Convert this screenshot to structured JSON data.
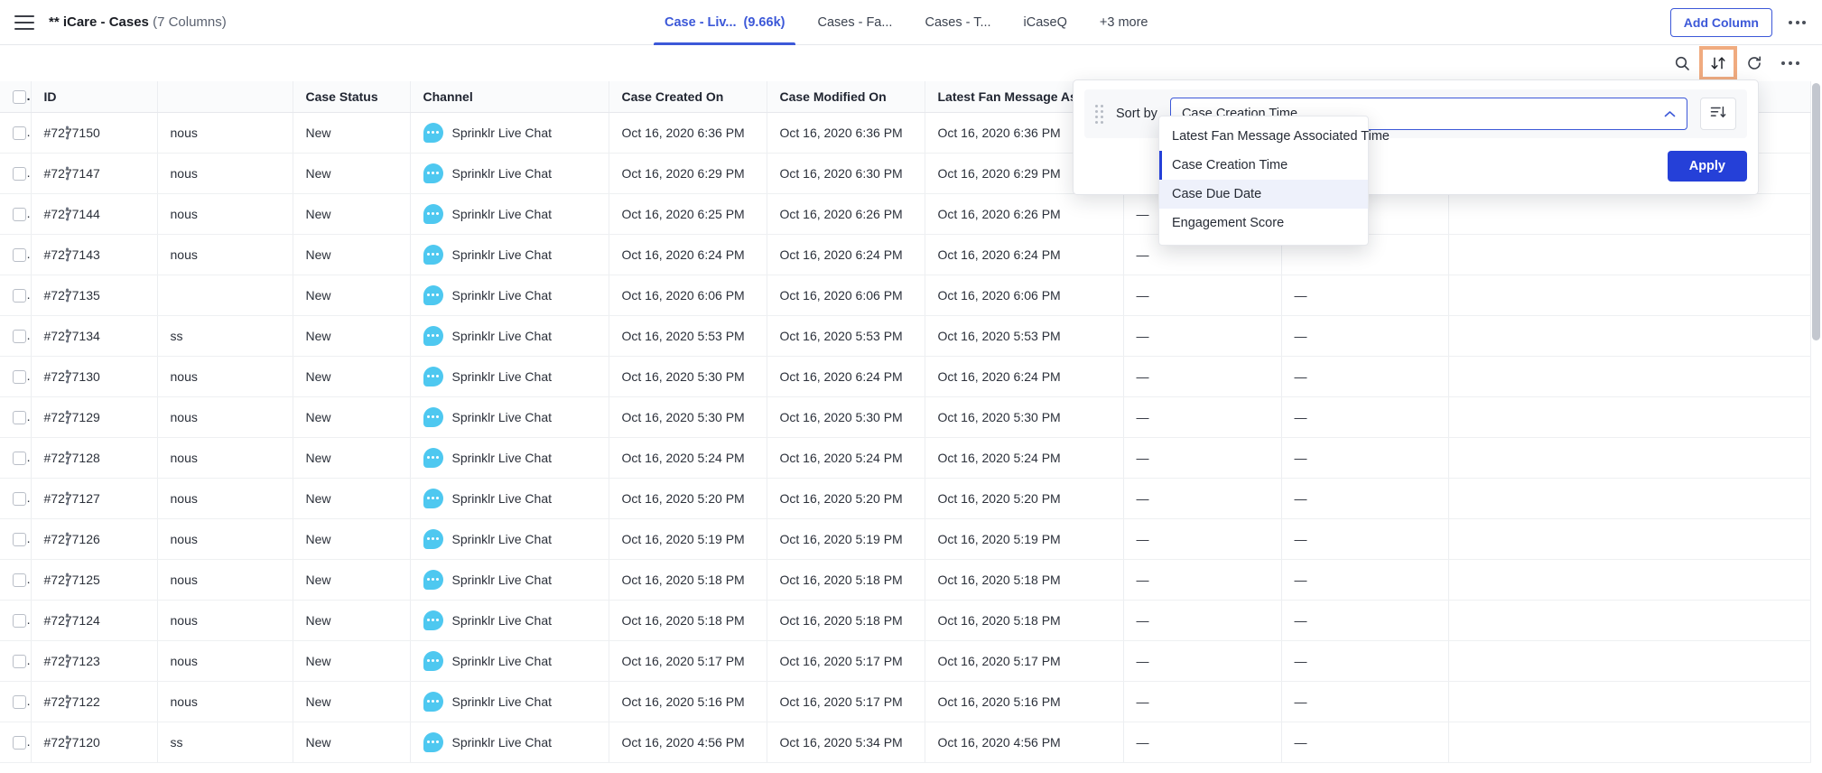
{
  "header": {
    "menu_icon": "hamburger-menu-icon",
    "title_bold": "** iCare - Cases",
    "title_columns": "(7 Columns)",
    "add_column_label": "Add Column",
    "overflow_icon": "kebab-menu-icon",
    "tabs": [
      {
        "label": "Case - Liv...",
        "count": "(9.66k)",
        "active": true
      },
      {
        "label": "Cases - Fa...",
        "count": "",
        "active": false
      },
      {
        "label": "Cases - T...",
        "count": "",
        "active": false
      },
      {
        "label": "iCaseQ",
        "count": "",
        "active": false
      },
      {
        "label": "+3 more",
        "count": "",
        "active": false
      }
    ]
  },
  "toolbar": {
    "search_icon": "search-icon",
    "sort_icon": "sort-arrows-icon",
    "refresh_icon": "refresh-icon",
    "more_icon": "more-horizontal-icon",
    "highlight_color": "#f0ab7f",
    "active_tool": "sort-arrows-icon"
  },
  "sort_panel": {
    "sort_by_label": "Sort by",
    "selected_field": "Case Creation Time",
    "caret_icon": "chevron-up-icon",
    "drag_handle_icon": "drag-handle-icon",
    "order_icon": "sort-descending-icon",
    "apply_label": "Apply",
    "options": [
      {
        "label": "Latest Fan Message Associated Time",
        "state": "normal"
      },
      {
        "label": "Case Creation Time",
        "state": "selected"
      },
      {
        "label": "Case Due Date",
        "state": "hover"
      },
      {
        "label": "Engagement Score",
        "state": "normal"
      }
    ]
  },
  "table": {
    "columns": [
      {
        "key": "check",
        "label": "",
        "cls": "c-check"
      },
      {
        "key": "id",
        "label": "ID",
        "cls": "c-id"
      },
      {
        "key": "name",
        "label": "",
        "cls": "c-name"
      },
      {
        "key": "status",
        "label": "Case Status",
        "cls": "c-status"
      },
      {
        "key": "channel",
        "label": "Channel",
        "cls": "c-channel"
      },
      {
        "key": "created",
        "label": "Case Created On",
        "cls": "c-created"
      },
      {
        "key": "modified",
        "label": "Case Modified On",
        "cls": "c-modified"
      },
      {
        "key": "latest",
        "label": "Latest Fan Message Associate...",
        "cls": "c-latest"
      },
      {
        "key": "d1",
        "label": "",
        "cls": "c-d1"
      },
      {
        "key": "d2",
        "label": "",
        "cls": "c-d2"
      },
      {
        "key": "d3",
        "label": "",
        "cls": "c-d3"
      }
    ],
    "channel_label": "Sprinklr Live Chat",
    "channel_icon": "chat-bubble-icon",
    "empty_value": "—",
    "rows": [
      {
        "id": "#7277150",
        "name": "nous",
        "status": "New",
        "created": "Oct 16, 2020 6:36 PM",
        "modified": "Oct 16, 2020 6:36 PM",
        "latest": "Oct 16, 2020 6:36 PM",
        "d1": "",
        "d2": "",
        "d3": ""
      },
      {
        "id": "#7277147",
        "name": "nous",
        "status": "New",
        "created": "Oct 16, 2020 6:29 PM",
        "modified": "Oct 16, 2020 6:30 PM",
        "latest": "Oct 16, 2020 6:29 PM",
        "d1": "",
        "d2": "",
        "d3": ""
      },
      {
        "id": "#7277144",
        "name": "nous",
        "status": "New",
        "created": "Oct 16, 2020 6:25 PM",
        "modified": "Oct 16, 2020 6:26 PM",
        "latest": "Oct 16, 2020 6:26 PM",
        "d1": "—",
        "d2": "",
        "d3": ""
      },
      {
        "id": "#7277143",
        "name": "nous",
        "status": "New",
        "created": "Oct 16, 2020 6:24 PM",
        "modified": "Oct 16, 2020 6:24 PM",
        "latest": "Oct 16, 2020 6:24 PM",
        "d1": "—",
        "d2": "",
        "d3": ""
      },
      {
        "id": "#7277135",
        "name": "",
        "status": "New",
        "created": "Oct 16, 2020 6:06 PM",
        "modified": "Oct 16, 2020 6:06 PM",
        "latest": "Oct 16, 2020 6:06 PM",
        "d1": "—",
        "d2": "—",
        "d3": ""
      },
      {
        "id": "#7277134",
        "name": "ss",
        "status": "New",
        "created": "Oct 16, 2020 5:53 PM",
        "modified": "Oct 16, 2020 5:53 PM",
        "latest": "Oct 16, 2020 5:53 PM",
        "d1": "—",
        "d2": "—",
        "d3": ""
      },
      {
        "id": "#7277130",
        "name": "nous",
        "status": "New",
        "created": "Oct 16, 2020 5:30 PM",
        "modified": "Oct 16, 2020 6:24 PM",
        "latest": "Oct 16, 2020 6:24 PM",
        "d1": "—",
        "d2": "—",
        "d3": ""
      },
      {
        "id": "#7277129",
        "name": "nous",
        "status": "New",
        "created": "Oct 16, 2020 5:30 PM",
        "modified": "Oct 16, 2020 5:30 PM",
        "latest": "Oct 16, 2020 5:30 PM",
        "d1": "—",
        "d2": "—",
        "d3": ""
      },
      {
        "id": "#7277128",
        "name": "nous",
        "status": "New",
        "created": "Oct 16, 2020 5:24 PM",
        "modified": "Oct 16, 2020 5:24 PM",
        "latest": "Oct 16, 2020 5:24 PM",
        "d1": "—",
        "d2": "—",
        "d3": ""
      },
      {
        "id": "#7277127",
        "name": "nous",
        "status": "New",
        "created": "Oct 16, 2020 5:20 PM",
        "modified": "Oct 16, 2020 5:20 PM",
        "latest": "Oct 16, 2020 5:20 PM",
        "d1": "—",
        "d2": "—",
        "d3": ""
      },
      {
        "id": "#7277126",
        "name": "nous",
        "status": "New",
        "created": "Oct 16, 2020 5:19 PM",
        "modified": "Oct 16, 2020 5:19 PM",
        "latest": "Oct 16, 2020 5:19 PM",
        "d1": "—",
        "d2": "—",
        "d3": ""
      },
      {
        "id": "#7277125",
        "name": "nous",
        "status": "New",
        "created": "Oct 16, 2020 5:18 PM",
        "modified": "Oct 16, 2020 5:18 PM",
        "latest": "Oct 16, 2020 5:18 PM",
        "d1": "—",
        "d2": "—",
        "d3": ""
      },
      {
        "id": "#7277124",
        "name": "nous",
        "status": "New",
        "created": "Oct 16, 2020 5:18 PM",
        "modified": "Oct 16, 2020 5:18 PM",
        "latest": "Oct 16, 2020 5:18 PM",
        "d1": "—",
        "d2": "—",
        "d3": ""
      },
      {
        "id": "#7277123",
        "name": "nous",
        "status": "New",
        "created": "Oct 16, 2020 5:17 PM",
        "modified": "Oct 16, 2020 5:17 PM",
        "latest": "Oct 16, 2020 5:17 PM",
        "d1": "—",
        "d2": "—",
        "d3": ""
      },
      {
        "id": "#7277122",
        "name": "nous",
        "status": "New",
        "created": "Oct 16, 2020 5:16 PM",
        "modified": "Oct 16, 2020 5:17 PM",
        "latest": "Oct 16, 2020 5:16 PM",
        "d1": "—",
        "d2": "—",
        "d3": ""
      },
      {
        "id": "#7277120",
        "name": "ss",
        "status": "New",
        "created": "Oct 16, 2020 4:56 PM",
        "modified": "Oct 16, 2020 5:34 PM",
        "latest": "Oct 16, 2020 4:56 PM",
        "d1": "—",
        "d2": "—",
        "d3": ""
      }
    ]
  }
}
